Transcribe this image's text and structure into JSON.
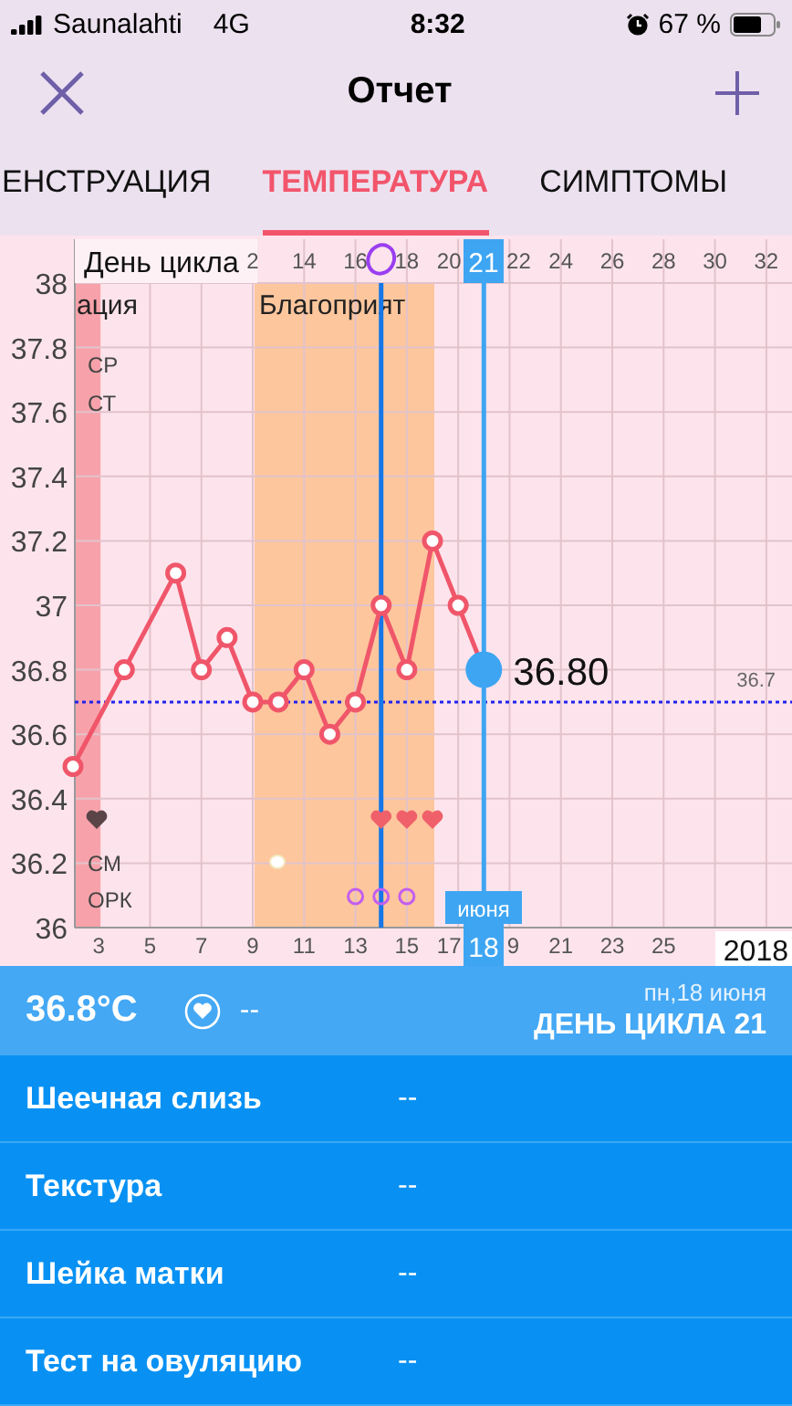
{
  "status_bar": {
    "carrier": "Saunalahti",
    "network": "4G",
    "time": "8:32",
    "battery": "67 %"
  },
  "header": {
    "title": "Отчет"
  },
  "tabs": [
    {
      "label": "ЕНСТРУАЦИЯ",
      "selected": false
    },
    {
      "label": "ТЕМПЕРАТУРА",
      "selected": true
    },
    {
      "label": "СИМПТОМЫ",
      "selected": false
    }
  ],
  "chart": {
    "header_label": "День цикла",
    "cycle_day_labels": [
      "2",
      "14",
      "16",
      "18",
      "20",
      "22",
      "24",
      "26",
      "28",
      "30",
      "32"
    ],
    "selected_cycle_day": "21",
    "menstruation_label": "ация",
    "fertile_label": "Благоприят",
    "row_labels": [
      "СР",
      "СТ",
      "СМ",
      "ОРК"
    ],
    "coverline_label": "36.7",
    "cut_date_label": "9",
    "selected_value": "36.80",
    "month_label": "июня",
    "selected_date": "18",
    "year_label": "2018",
    "chart_data": {
      "type": "line",
      "x": [
        2,
        3,
        4,
        5,
        6,
        7,
        8,
        9,
        10,
        11,
        12,
        13,
        14,
        15,
        16,
        17,
        18
      ],
      "series": [
        {
          "color": "#f0566a",
          "marker": "o",
          "values": [
            36.5,
            null,
            36.8,
            null,
            37.1,
            36.8,
            36.9,
            36.7,
            36.7,
            36.8,
            36.6,
            36.7,
            37.0,
            36.8,
            37.2,
            37.0,
            36.8
          ]
        }
      ],
      "xlim": [
        2,
        30
      ],
      "ylim": [
        36,
        38
      ],
      "grid": true,
      "bands": [
        {
          "axis": "x",
          "from": 2,
          "to": 3,
          "color": "#f7a2aa"
        },
        {
          "axis": "x",
          "from": 9,
          "to": 16,
          "color": "#fdc69d"
        }
      ],
      "ref_lines": [
        {
          "axis": "y",
          "value": 36.7,
          "color": "#2222ee"
        },
        {
          "axis": "x",
          "value": 14,
          "color": "#1577e8"
        },
        {
          "axis": "x",
          "value": 18,
          "color": "#3ea5f2"
        }
      ],
      "xticks": [
        {
          "value": 3,
          "label": "3"
        },
        {
          "value": 5,
          "label": "5"
        },
        {
          "value": 7,
          "label": "7"
        },
        {
          "value": 9,
          "label": "9"
        },
        {
          "value": 11,
          "label": "11"
        },
        {
          "value": 13,
          "label": "13"
        },
        {
          "value": 15,
          "label": "15"
        },
        {
          "value": 17,
          "label": "17"
        },
        {
          "value": 21,
          "label": "21"
        },
        {
          "value": 23,
          "label": "23"
        },
        {
          "value": 25,
          "label": "25"
        }
      ],
      "yticks": [
        {
          "value": 36,
          "label": "36"
        },
        {
          "value": 36.2,
          "label": "36.2"
        },
        {
          "value": 36.4,
          "label": "36.4"
        },
        {
          "value": 36.6,
          "label": "36.6"
        },
        {
          "value": 36.8,
          "label": "36.8"
        },
        {
          "value": 37,
          "label": "37"
        },
        {
          "value": 37.2,
          "label": "37.2"
        },
        {
          "value": 37.4,
          "label": "37.4"
        },
        {
          "value": 37.6,
          "label": "37.6"
        },
        {
          "value": 37.8,
          "label": "37.8"
        },
        {
          "value": 38,
          "label": "38"
        }
      ]
    }
  },
  "summary": {
    "temperature": "36.8°C",
    "sex_value": "--",
    "date": "пн,18 июня",
    "cycle_day": "ДЕНЬ ЦИКЛА 21"
  },
  "rows": [
    {
      "label": "Шеечная слизь",
      "value": "--"
    },
    {
      "label": "Текстура",
      "value": "--"
    },
    {
      "label": "Шейка матки",
      "value": "--"
    },
    {
      "label": "Тест на овуляцию",
      "value": "--"
    }
  ]
}
